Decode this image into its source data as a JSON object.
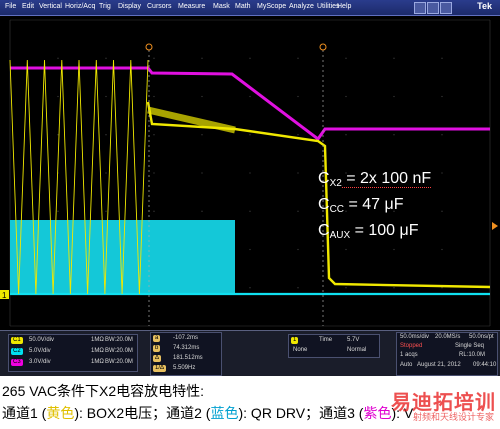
{
  "menubar": {
    "items": [
      "File",
      "Edit",
      "Vertical",
      "Horiz/Acq",
      "Trig",
      "Display",
      "Cursors",
      "Measure",
      "Mask",
      "Math",
      "MyScope",
      "Analyze",
      "Utilities",
      "Help"
    ],
    "logo": "Tek"
  },
  "scope": {
    "annotation": {
      "line1_pre": "C",
      "line1_sub": "X2",
      "line1_post": " = 2x 100 nF",
      "line2_pre": "C",
      "line2_sub": "CC",
      "line2_post": " = 47 μF",
      "line3_pre": "C",
      "line3_sub": "AUX",
      "line3_post": " = 100 μF"
    },
    "markers": {
      "ch1": "1",
      "cursor_a": "a",
      "cursor_b": "b"
    },
    "colors": {
      "ch1": "#f0e800",
      "ch2": "#00e0f0",
      "ch3": "#f000e0"
    }
  },
  "panel": {
    "channels": [
      {
        "chip": "C1",
        "scale": "50.0V/div",
        "imp": "1MΩ",
        "bw": "BW:20.0M",
        "color": "#f0e800"
      },
      {
        "chip": "C2",
        "scale": "5.0V/div",
        "imp": "1MΩ",
        "bw": "BW:20.0M",
        "color": "#00e0f0"
      },
      {
        "chip": "C3",
        "scale": "3.0V/div",
        "imp": "1MΩ",
        "bw": "BW:20.0M",
        "color": "#f000e0"
      }
    ],
    "cursors": [
      {
        "chip": "a",
        "value": "-107.2ms"
      },
      {
        "chip": "b",
        "value": "74.312ms"
      },
      {
        "chip": "Δ",
        "value": "181.512ms"
      },
      {
        "chip": "1/Δ",
        "value": "5.509Hz"
      }
    ],
    "trigger": {
      "label": "Time",
      "level": "5.7V",
      "mode1": "None",
      "mode2": "Normal"
    },
    "timebase": {
      "scale": "50.0ms/div",
      "rate": "20.0MS/s",
      "res": "50.0ns/pt",
      "state": "Stopped",
      "seq": "Single Seq",
      "acqs": "1 acqs",
      "rl": "RL:10.0M",
      "auto": "Auto",
      "date": "August 21, 2012",
      "time": "09:44:10"
    }
  },
  "caption": {
    "line1": "265 VAC条件下X2电容放电特性:",
    "line2_a": "通道1 (",
    "line2_yellow": "黄色",
    "line2_b": "): BOX2电压；通道2 (",
    "line2_blue": "蓝色",
    "line2_c": "): QR DRV；通道3 (",
    "line2_pink": "紫色",
    "line2_d": "): V"
  },
  "watermark": {
    "main": "易迪拓培训",
    "sub": "射频和天线设计专家"
  }
}
